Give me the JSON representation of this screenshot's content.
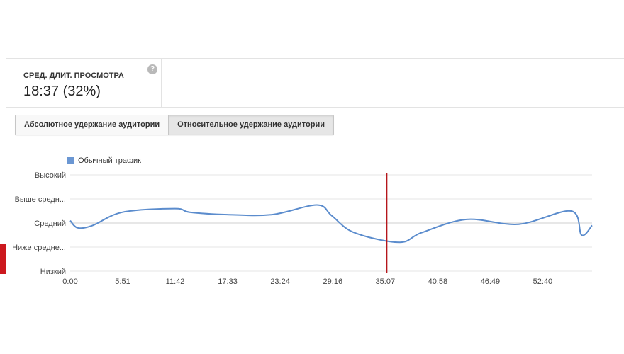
{
  "metric": {
    "label": "СРЕД. ДЛИТ. ПРОСМОТРА",
    "value": "18:37 (32%)",
    "help_glyph": "?"
  },
  "tabs": [
    {
      "label": "Абсолютное удержание аудитории",
      "active": false
    },
    {
      "label": "Относительное удержание аудитории",
      "active": true
    }
  ],
  "colors": {
    "series": "#5b8ccd",
    "marker": "#b5161b",
    "grid": "#e6e6e6",
    "accent_tab": "#cc181e"
  },
  "chart_data": {
    "type": "line",
    "legend": [
      {
        "name": "Обычный трафик",
        "color": "#6b97d3"
      }
    ],
    "legend_placement": "top-left",
    "y_tick_labels": [
      "Высокий",
      "Выше средн...",
      "Средний",
      "Ниже средне...",
      "Низкий"
    ],
    "x_tick_labels": [
      "0:00",
      "5:51",
      "11:42",
      "17:33",
      "23:24",
      "29:16",
      "35:07",
      "40:58",
      "46:49",
      "52:40"
    ],
    "xlim_seconds": [
      0,
      3490
    ],
    "ylim_levels": [
      0,
      4
    ],
    "grid": true,
    "current_position": "35:07",
    "series": [
      {
        "name": "Обычный трафик",
        "x_seconds": [
          0,
          50,
          150,
          350,
          700,
          800,
          1050,
          1350,
          1650,
          1750,
          1900,
          2200,
          2350,
          2650,
          3000,
          3350,
          3420,
          3490
        ],
        "y_level": [
          2.1,
          1.8,
          1.9,
          2.45,
          2.6,
          2.45,
          2.35,
          2.35,
          2.75,
          2.3,
          1.6,
          1.2,
          1.6,
          2.15,
          1.95,
          2.5,
          1.5,
          1.9
        ]
      }
    ]
  }
}
